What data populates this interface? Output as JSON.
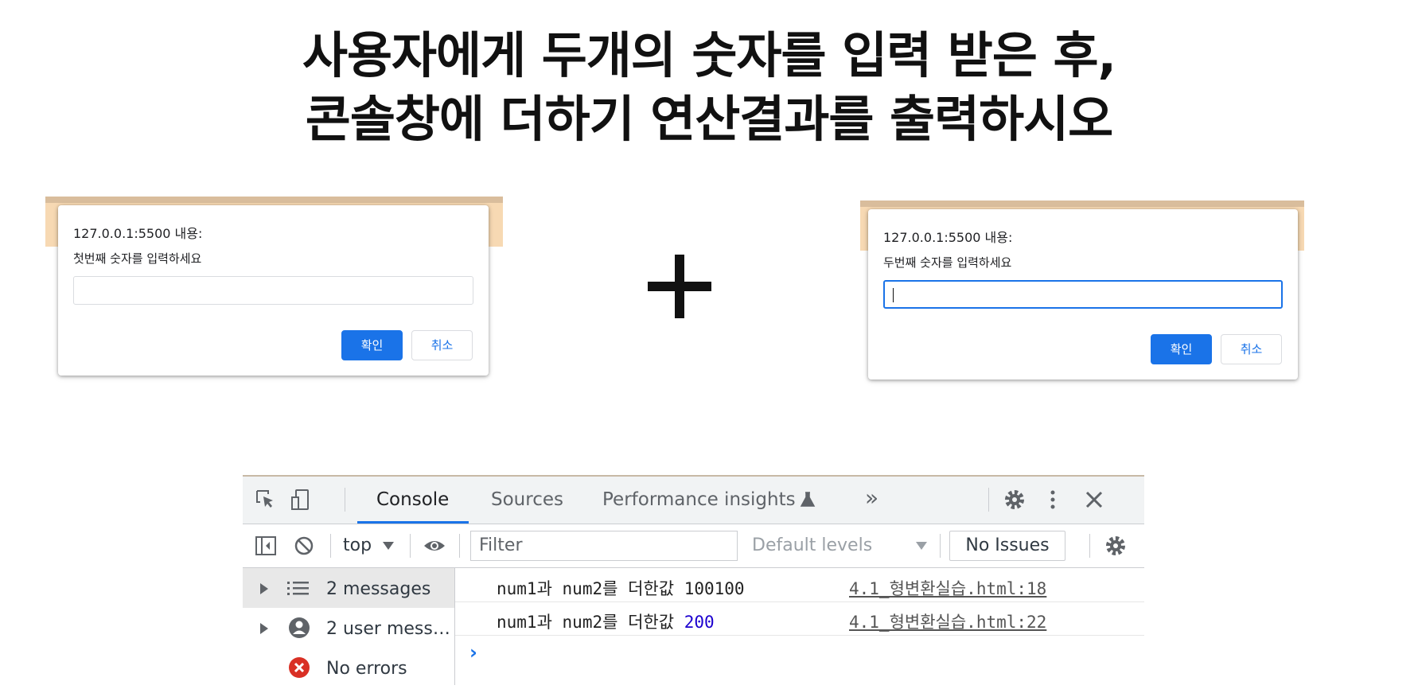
{
  "title": {
    "line1": "사용자에게 두개의 숫자를 입력 받은 후,",
    "line2": "콘솔창에 더하기 연산결과를 출력하시오"
  },
  "dialogs": [
    {
      "origin": "127.0.0.1:5500 내용:",
      "message": "첫번째 숫자를 입력하세요",
      "input_value": "",
      "ok_label": "확인",
      "cancel_label": "취소"
    },
    {
      "origin": "127.0.0.1:5500 내용:",
      "message": "두번째 숫자를 입력하세요",
      "input_value": "",
      "ok_label": "확인",
      "cancel_label": "취소"
    }
  ],
  "operator_icon": "plus-icon",
  "devtools": {
    "tabs": [
      {
        "label": "Console",
        "active": true
      },
      {
        "label": "Sources",
        "active": false
      },
      {
        "label": "Performance insights",
        "active": false
      }
    ],
    "toolbar": {
      "context": "top",
      "filter_placeholder": "Filter",
      "levels": "Default levels",
      "issues": "No Issues"
    },
    "sidebar": [
      {
        "label": "2 messages",
        "icon": "list-icon",
        "selected": true
      },
      {
        "label": "2 user mess…",
        "icon": "user-icon",
        "selected": false
      },
      {
        "label": "No errors",
        "icon": "error-icon",
        "selected": false
      }
    ],
    "logs": [
      {
        "text": "num1과 num2를 더한값",
        "value": "100100",
        "value_type": "string",
        "source": "4.1_형변환실습.html:18"
      },
      {
        "text": "num1과 num2를 더한값",
        "value": "200",
        "value_type": "number",
        "source": "4.1_형변환실습.html:22"
      }
    ],
    "colors": {
      "accent": "#1a73e8",
      "number": "#1c00cf",
      "error": "#d93025"
    }
  }
}
